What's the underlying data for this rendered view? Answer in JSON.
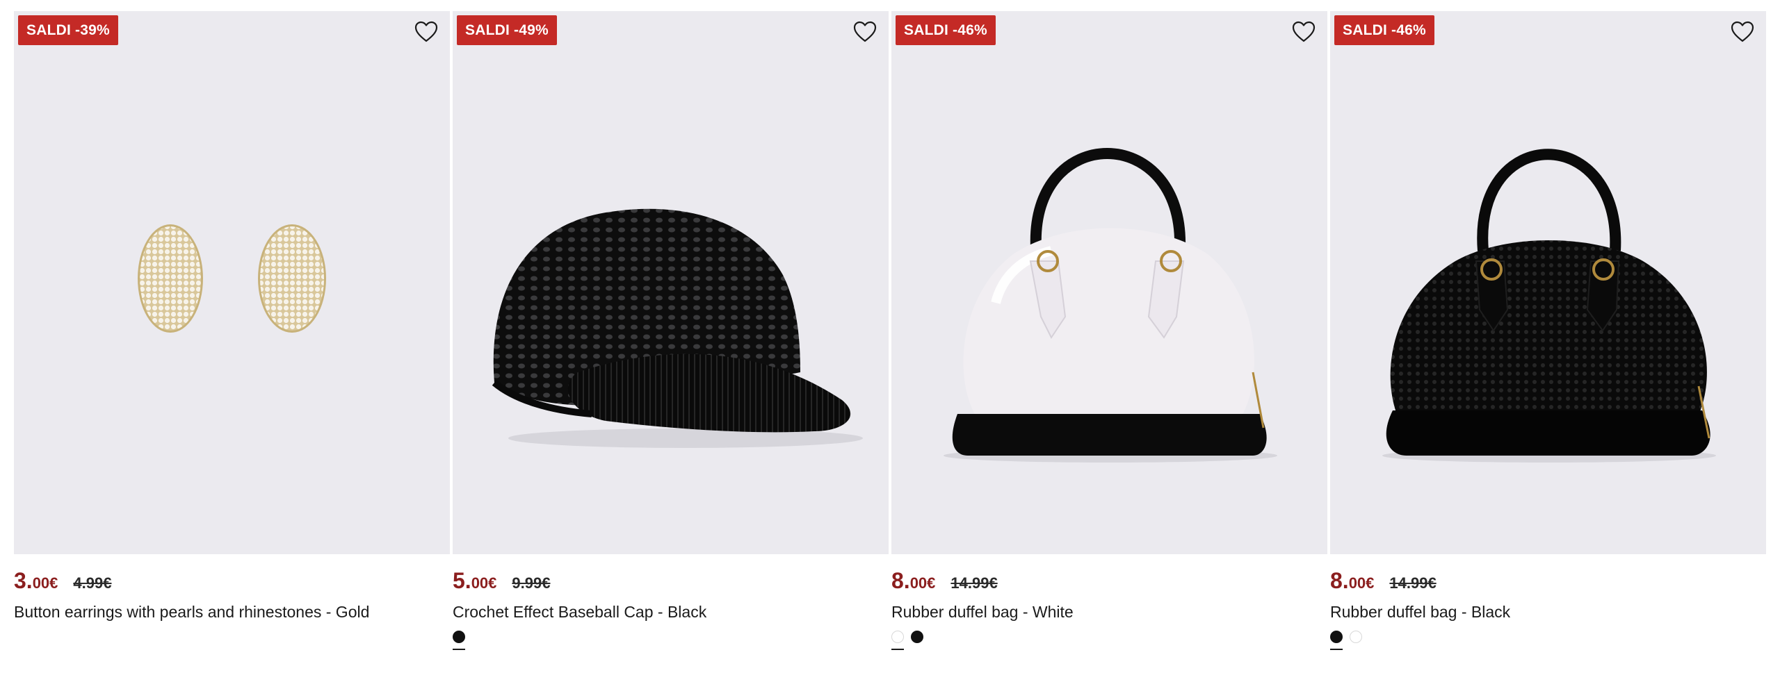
{
  "products": [
    {
      "badge": "SALDI -39%",
      "price_int": "3.",
      "price_dec": "00€",
      "price_old": "4.99€",
      "title": "Button earrings with pearls and rhinestones - Gold",
      "swatches": []
    },
    {
      "badge": "SALDI -49%",
      "price_int": "5.",
      "price_dec": "00€",
      "price_old": "9.99€",
      "title": "Crochet Effect Baseball Cap - Black",
      "swatches": [
        {
          "color": "#111111",
          "selected": true
        }
      ]
    },
    {
      "badge": "SALDI -46%",
      "price_int": "8.",
      "price_dec": "00€",
      "price_old": "14.99€",
      "title": "Rubber duffel bag - White",
      "swatches": [
        {
          "color": "#ffffff",
          "selected": true
        },
        {
          "color": "#111111",
          "selected": false
        }
      ]
    },
    {
      "badge": "SALDI -46%",
      "price_int": "8.",
      "price_dec": "00€",
      "price_old": "14.99€",
      "title": "Rubber duffel bag - Black",
      "swatches": [
        {
          "color": "#111111",
          "selected": true
        },
        {
          "color": "#ffffff",
          "selected": false
        }
      ]
    }
  ],
  "colors": {
    "badge_bg": "#c42a26",
    "price": "#8b1e1e",
    "image_bg": "#ebeaef"
  },
  "icons": {
    "wishlist": "heart-outline-icon"
  }
}
